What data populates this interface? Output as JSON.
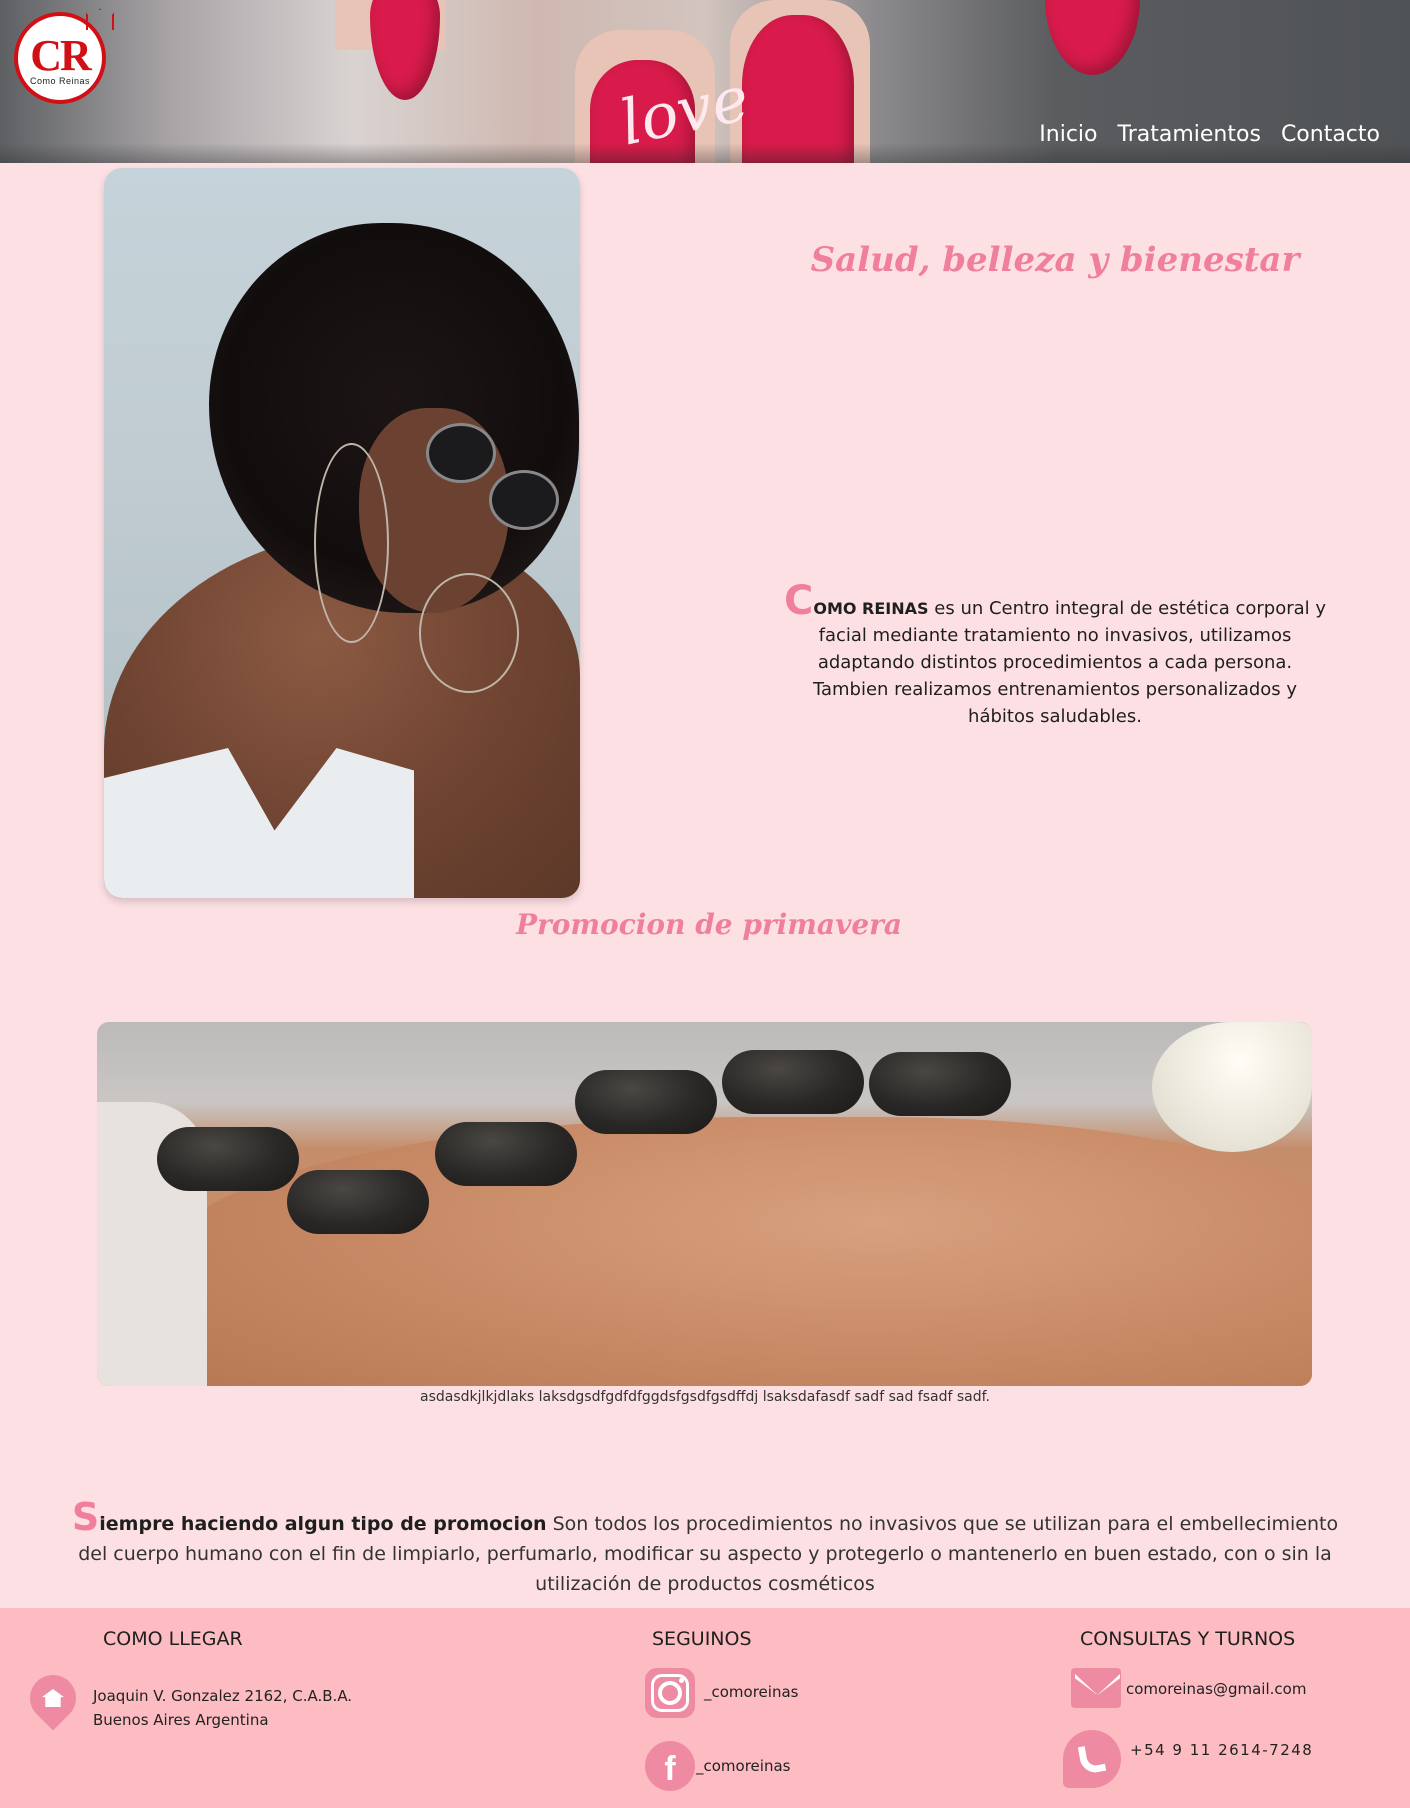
{
  "header": {
    "logo": {
      "initials": "CR",
      "name": "Como Reinas"
    },
    "banner_text": "love",
    "nav": [
      "Inicio",
      "Tratamientos",
      "Contacto"
    ]
  },
  "hero": {
    "title": "Salud, belleza y bienestar",
    "drop_cap": "C",
    "brand": "OMO REINAS",
    "text": " es un Centro integral de estética corporal y facial mediante tratamiento no invasivos, utilizamos adaptando distintos procedimientos a cada persona. Tambien realizamos entrenamientos personalizados y hábitos saludables."
  },
  "promo": {
    "title": "Promocion de primavera",
    "caption": "asdasdkjlkjdlaks laksdgsdfgdfdfggdsfgsdfgsdffdj lsaksdafasdf sadf sad fsadf sadf."
  },
  "about": {
    "drop_cap": "S",
    "lead": "iempre haciendo algun tipo de promocion",
    "text": " Son todos los procedimientos no invasivos que se utilizan para el embellecimiento del cuerpo humano con el fin de limpiarlo, perfumarlo, modificar su aspecto y protegerlo o mantenerlo en buen estado, con o sin la utilización de productos cosméticos"
  },
  "footer": {
    "location": {
      "heading": "COMO LLEGAR",
      "line1": "Joaquin V. Gonzalez 2162, C.A.B.A.",
      "line2": "Buenos Aires Argentina",
      "icon": "location-pin-icon"
    },
    "social": {
      "heading": "SEGUINOS",
      "instagram": "_comoreinas",
      "facebook": "_comoreinas",
      "fb_glyph": "f"
    },
    "contact": {
      "heading": "CONSULTAS Y TURNOS",
      "email": "comoreinas@gmail.com",
      "phone": "+54 9 11 2614-7248"
    }
  },
  "colors": {
    "background": "#fde0e3",
    "accent": "#ef7f9b",
    "footer": "#fcbcc1",
    "icon": "#ee8ba3",
    "logo_red": "#d10f14"
  }
}
